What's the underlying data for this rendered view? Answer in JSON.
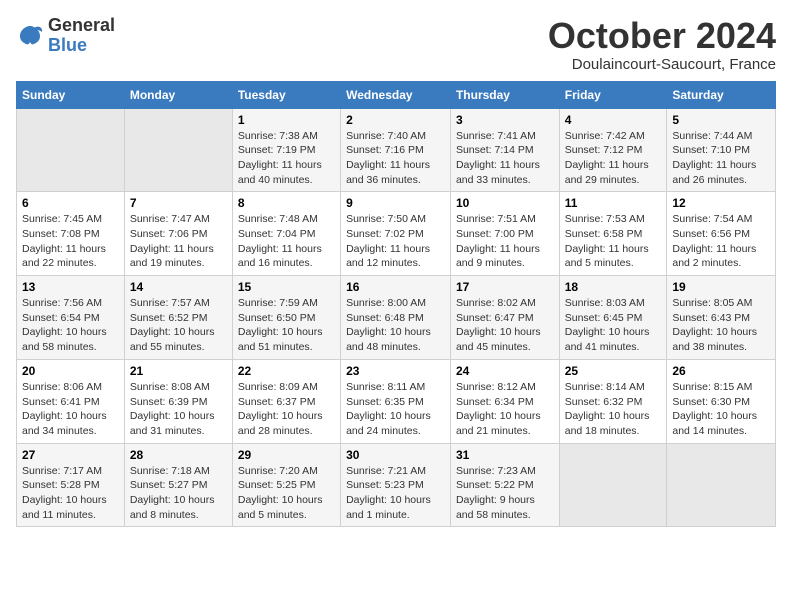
{
  "logo": {
    "general": "General",
    "blue": "Blue"
  },
  "header": {
    "month": "October 2024",
    "location": "Doulaincourt-Saucourt, France"
  },
  "weekdays": [
    "Sunday",
    "Monday",
    "Tuesday",
    "Wednesday",
    "Thursday",
    "Friday",
    "Saturday"
  ],
  "weeks": [
    [
      {
        "day": "",
        "sunrise": "",
        "sunset": "",
        "daylight": ""
      },
      {
        "day": "",
        "sunrise": "",
        "sunset": "",
        "daylight": ""
      },
      {
        "day": "1",
        "sunrise": "Sunrise: 7:38 AM",
        "sunset": "Sunset: 7:19 PM",
        "daylight": "Daylight: 11 hours and 40 minutes."
      },
      {
        "day": "2",
        "sunrise": "Sunrise: 7:40 AM",
        "sunset": "Sunset: 7:16 PM",
        "daylight": "Daylight: 11 hours and 36 minutes."
      },
      {
        "day": "3",
        "sunrise": "Sunrise: 7:41 AM",
        "sunset": "Sunset: 7:14 PM",
        "daylight": "Daylight: 11 hours and 33 minutes."
      },
      {
        "day": "4",
        "sunrise": "Sunrise: 7:42 AM",
        "sunset": "Sunset: 7:12 PM",
        "daylight": "Daylight: 11 hours and 29 minutes."
      },
      {
        "day": "5",
        "sunrise": "Sunrise: 7:44 AM",
        "sunset": "Sunset: 7:10 PM",
        "daylight": "Daylight: 11 hours and 26 minutes."
      }
    ],
    [
      {
        "day": "6",
        "sunrise": "Sunrise: 7:45 AM",
        "sunset": "Sunset: 7:08 PM",
        "daylight": "Daylight: 11 hours and 22 minutes."
      },
      {
        "day": "7",
        "sunrise": "Sunrise: 7:47 AM",
        "sunset": "Sunset: 7:06 PM",
        "daylight": "Daylight: 11 hours and 19 minutes."
      },
      {
        "day": "8",
        "sunrise": "Sunrise: 7:48 AM",
        "sunset": "Sunset: 7:04 PM",
        "daylight": "Daylight: 11 hours and 16 minutes."
      },
      {
        "day": "9",
        "sunrise": "Sunrise: 7:50 AM",
        "sunset": "Sunset: 7:02 PM",
        "daylight": "Daylight: 11 hours and 12 minutes."
      },
      {
        "day": "10",
        "sunrise": "Sunrise: 7:51 AM",
        "sunset": "Sunset: 7:00 PM",
        "daylight": "Daylight: 11 hours and 9 minutes."
      },
      {
        "day": "11",
        "sunrise": "Sunrise: 7:53 AM",
        "sunset": "Sunset: 6:58 PM",
        "daylight": "Daylight: 11 hours and 5 minutes."
      },
      {
        "day": "12",
        "sunrise": "Sunrise: 7:54 AM",
        "sunset": "Sunset: 6:56 PM",
        "daylight": "Daylight: 11 hours and 2 minutes."
      }
    ],
    [
      {
        "day": "13",
        "sunrise": "Sunrise: 7:56 AM",
        "sunset": "Sunset: 6:54 PM",
        "daylight": "Daylight: 10 hours and 58 minutes."
      },
      {
        "day": "14",
        "sunrise": "Sunrise: 7:57 AM",
        "sunset": "Sunset: 6:52 PM",
        "daylight": "Daylight: 10 hours and 55 minutes."
      },
      {
        "day": "15",
        "sunrise": "Sunrise: 7:59 AM",
        "sunset": "Sunset: 6:50 PM",
        "daylight": "Daylight: 10 hours and 51 minutes."
      },
      {
        "day": "16",
        "sunrise": "Sunrise: 8:00 AM",
        "sunset": "Sunset: 6:48 PM",
        "daylight": "Daylight: 10 hours and 48 minutes."
      },
      {
        "day": "17",
        "sunrise": "Sunrise: 8:02 AM",
        "sunset": "Sunset: 6:47 PM",
        "daylight": "Daylight: 10 hours and 45 minutes."
      },
      {
        "day": "18",
        "sunrise": "Sunrise: 8:03 AM",
        "sunset": "Sunset: 6:45 PM",
        "daylight": "Daylight: 10 hours and 41 minutes."
      },
      {
        "day": "19",
        "sunrise": "Sunrise: 8:05 AM",
        "sunset": "Sunset: 6:43 PM",
        "daylight": "Daylight: 10 hours and 38 minutes."
      }
    ],
    [
      {
        "day": "20",
        "sunrise": "Sunrise: 8:06 AM",
        "sunset": "Sunset: 6:41 PM",
        "daylight": "Daylight: 10 hours and 34 minutes."
      },
      {
        "day": "21",
        "sunrise": "Sunrise: 8:08 AM",
        "sunset": "Sunset: 6:39 PM",
        "daylight": "Daylight: 10 hours and 31 minutes."
      },
      {
        "day": "22",
        "sunrise": "Sunrise: 8:09 AM",
        "sunset": "Sunset: 6:37 PM",
        "daylight": "Daylight: 10 hours and 28 minutes."
      },
      {
        "day": "23",
        "sunrise": "Sunrise: 8:11 AM",
        "sunset": "Sunset: 6:35 PM",
        "daylight": "Daylight: 10 hours and 24 minutes."
      },
      {
        "day": "24",
        "sunrise": "Sunrise: 8:12 AM",
        "sunset": "Sunset: 6:34 PM",
        "daylight": "Daylight: 10 hours and 21 minutes."
      },
      {
        "day": "25",
        "sunrise": "Sunrise: 8:14 AM",
        "sunset": "Sunset: 6:32 PM",
        "daylight": "Daylight: 10 hours and 18 minutes."
      },
      {
        "day": "26",
        "sunrise": "Sunrise: 8:15 AM",
        "sunset": "Sunset: 6:30 PM",
        "daylight": "Daylight: 10 hours and 14 minutes."
      }
    ],
    [
      {
        "day": "27",
        "sunrise": "Sunrise: 7:17 AM",
        "sunset": "Sunset: 5:28 PM",
        "daylight": "Daylight: 10 hours and 11 minutes."
      },
      {
        "day": "28",
        "sunrise": "Sunrise: 7:18 AM",
        "sunset": "Sunset: 5:27 PM",
        "daylight": "Daylight: 10 hours and 8 minutes."
      },
      {
        "day": "29",
        "sunrise": "Sunrise: 7:20 AM",
        "sunset": "Sunset: 5:25 PM",
        "daylight": "Daylight: 10 hours and 5 minutes."
      },
      {
        "day": "30",
        "sunrise": "Sunrise: 7:21 AM",
        "sunset": "Sunset: 5:23 PM",
        "daylight": "Daylight: 10 hours and 1 minute."
      },
      {
        "day": "31",
        "sunrise": "Sunrise: 7:23 AM",
        "sunset": "Sunset: 5:22 PM",
        "daylight": "Daylight: 9 hours and 58 minutes."
      },
      {
        "day": "",
        "sunrise": "",
        "sunset": "",
        "daylight": ""
      },
      {
        "day": "",
        "sunrise": "",
        "sunset": "",
        "daylight": ""
      }
    ]
  ]
}
